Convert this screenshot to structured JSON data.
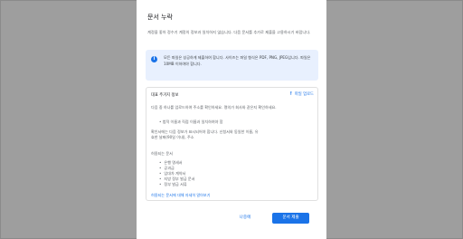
{
  "dialog": {
    "title": "문서 누락",
    "description": "계정을 좋아 정수기 계정의 정보과 일치하지 않습니다. 다음 문서를 추가로 제출을 고용하시기 바랍니다.",
    "info": "모든 파일은 성공하게 제출하여 합니다. 사이즈는 파일 형식은 PDF, PNG, JPEG입니다. 파일은 10MB 이하여야 합니다.",
    "upload": {
      "title": "대표 주거지 정보",
      "button": "파일 업로드",
      "subtitle": "다음 중 하나를 업로드하여 주소를 확인하세요. 명의가 회사와 같은지 확인하세요.",
      "bullet": "법적 이름과 직접 이름과 일치하여야 함",
      "paragraph": "확인서에는 다음 정보가 표시되어야 합니다. 신청서와 동일한 이름, 유효한 날짜(90일 이내), 주소",
      "list_heading": "허용되는 문서",
      "list": [
        "은행 명세서",
        "공과금",
        "임대차 계약서",
        "지방 정부 발급 문서",
        "정부 발급 서류"
      ],
      "more_link": "허용되는 문서에 대해 자세히 알아보기"
    },
    "buttons": {
      "later": "나중에",
      "submit": "문서 제출"
    }
  }
}
